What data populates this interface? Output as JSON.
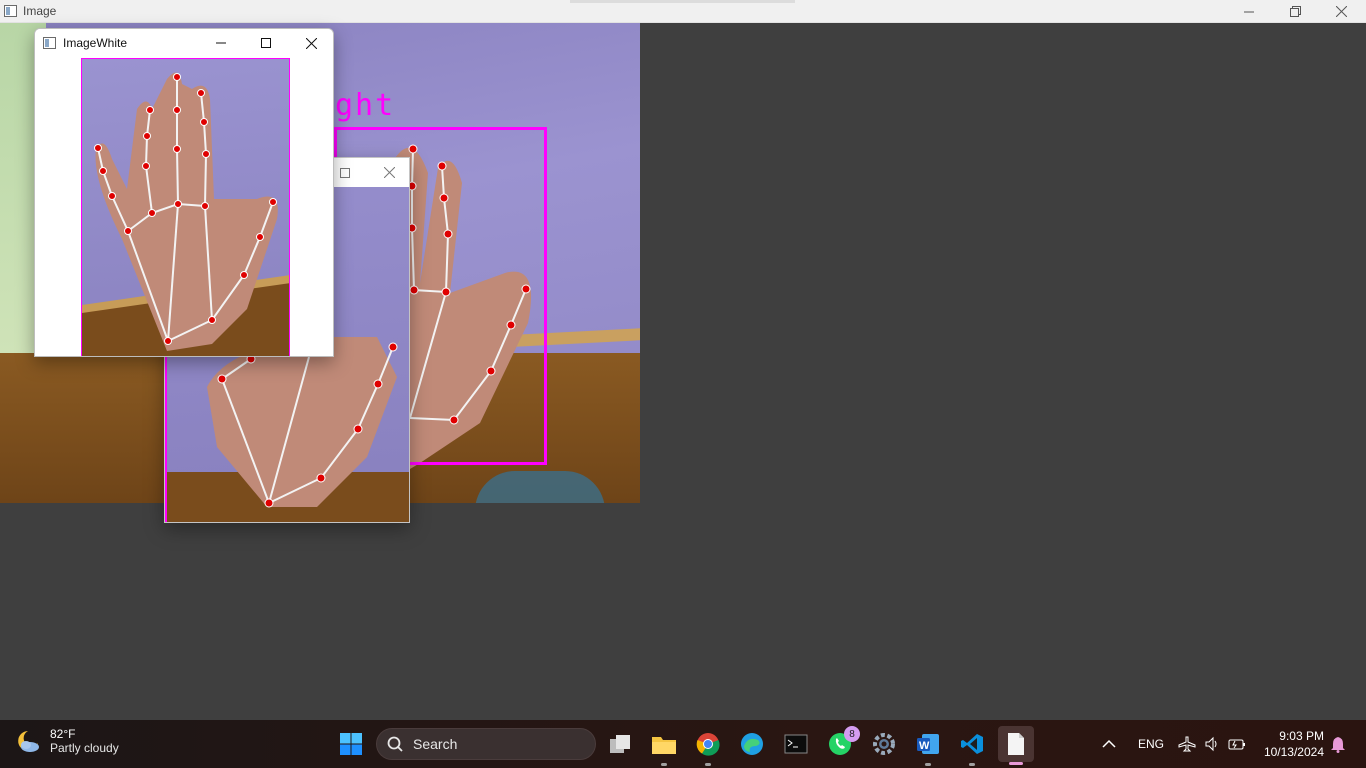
{
  "main_window": {
    "title": "Image",
    "hand_label": "ght",
    "bbox_color": "#ff00ff"
  },
  "crop_window": {
    "title": ""
  },
  "white_window": {
    "title": "ImageWhite"
  },
  "taskbar": {
    "weather": {
      "temp": "82°F",
      "condition": "Partly cloudy"
    },
    "search_label": "Search",
    "apps": [
      {
        "name": "task-view"
      },
      {
        "name": "file-explorer"
      },
      {
        "name": "chrome"
      },
      {
        "name": "edge"
      },
      {
        "name": "terminal"
      },
      {
        "name": "whatsapp",
        "badge": "8"
      },
      {
        "name": "settings"
      },
      {
        "name": "word"
      },
      {
        "name": "vscode"
      },
      {
        "name": "notepad",
        "active": true
      }
    ],
    "tray": {
      "language": "ENG"
    },
    "clock": {
      "time": "9:03 PM",
      "date": "10/13/2024"
    }
  },
  "colors": {
    "accent": "#ff00ff",
    "landmark_dot": "#e00000",
    "landmark_line": "#f3f3f3",
    "taskbar": "#2a1612"
  }
}
